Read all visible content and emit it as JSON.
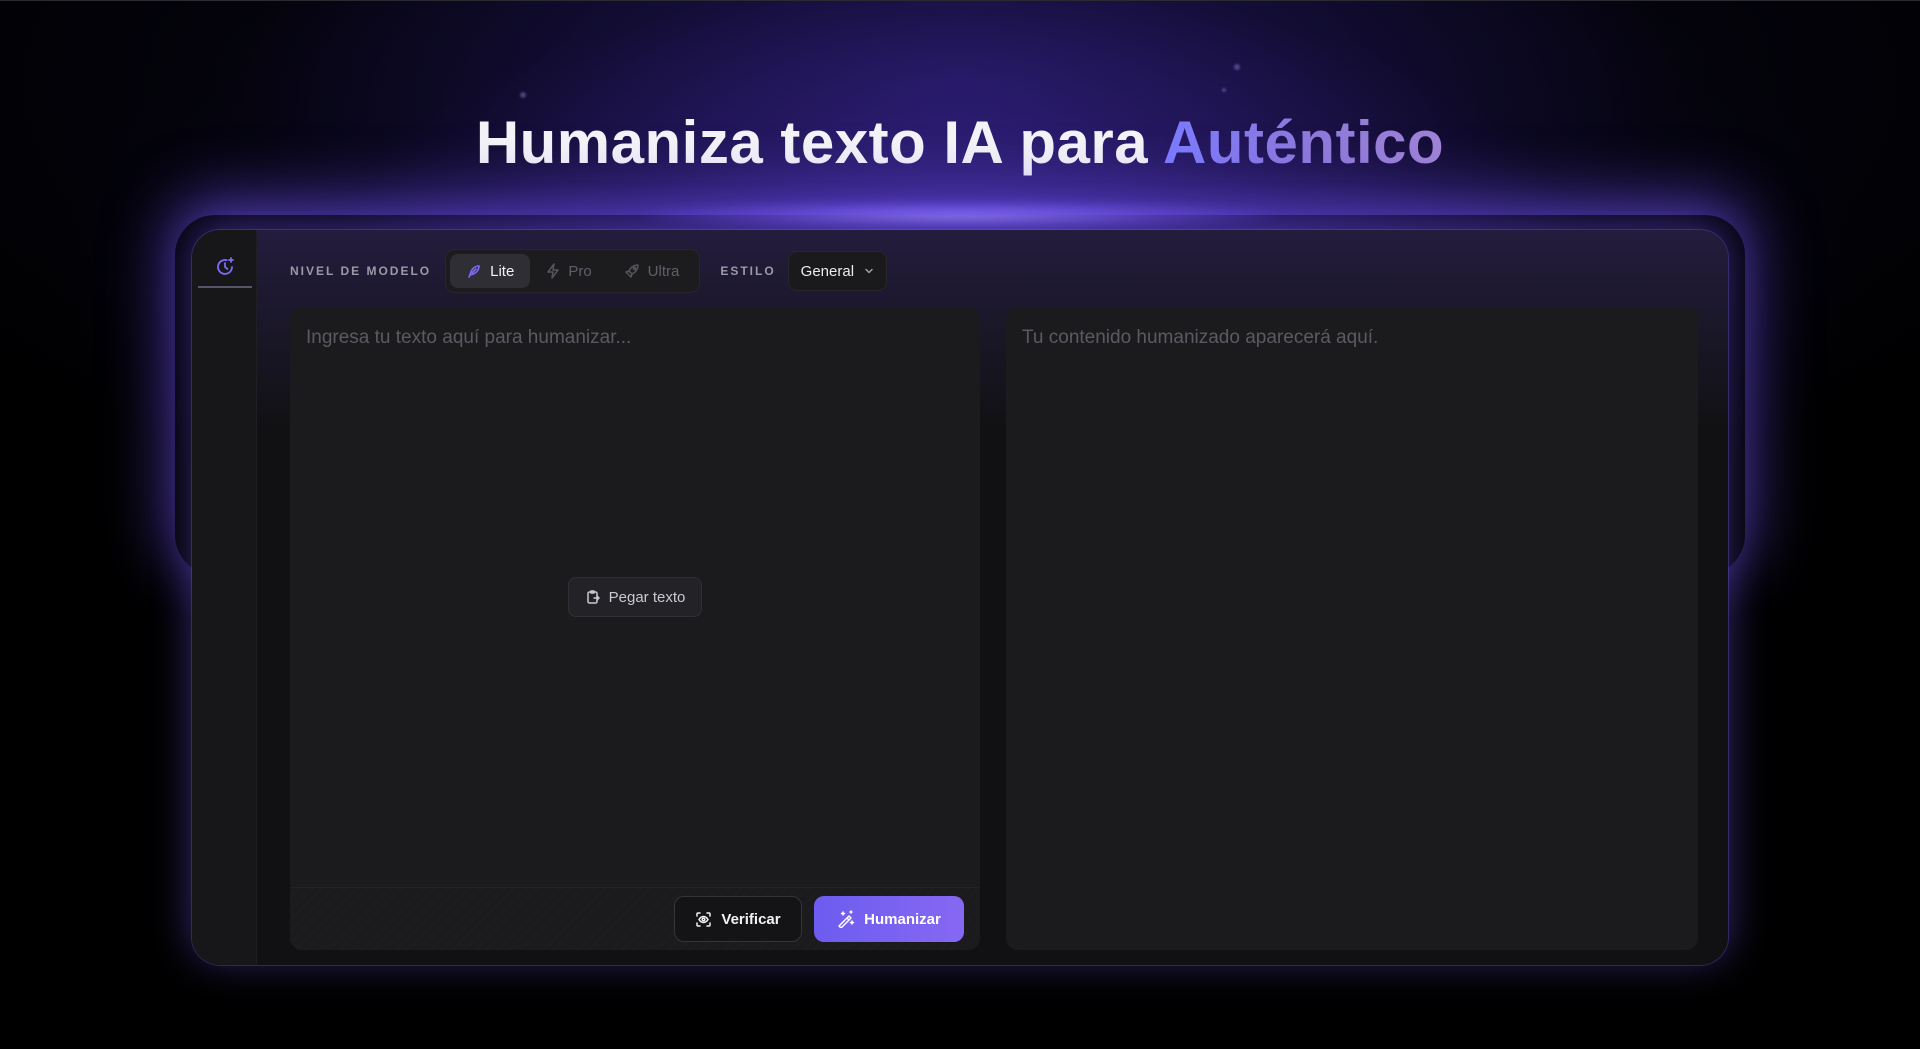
{
  "hero": {
    "title_main": "Humaniza texto IA para ",
    "title_accent": "Auténtico"
  },
  "side_rail": {
    "active_tab_icon": "history-sparkle-icon"
  },
  "toolbar": {
    "model_level_label": "NIVEL DE MODELO",
    "model_options": [
      {
        "label": "Lite",
        "icon": "feather-icon",
        "active": true
      },
      {
        "label": "Pro",
        "icon": "lightning-icon",
        "active": false
      },
      {
        "label": "Ultra",
        "icon": "rocket-icon",
        "active": false
      }
    ],
    "style_label": "ESTILO",
    "style_value": "General"
  },
  "editor": {
    "placeholder": "Ingresa tu texto aquí para humanizar...",
    "paste_label": "Pegar texto",
    "verify_label": "Verificar",
    "humanize_label": "Humanizar"
  },
  "output": {
    "placeholder": "Tu contenido humanizado aparecerá aquí."
  },
  "colors": {
    "accent": "#7b6cf6",
    "background": "#000000",
    "panel": "#111113"
  }
}
